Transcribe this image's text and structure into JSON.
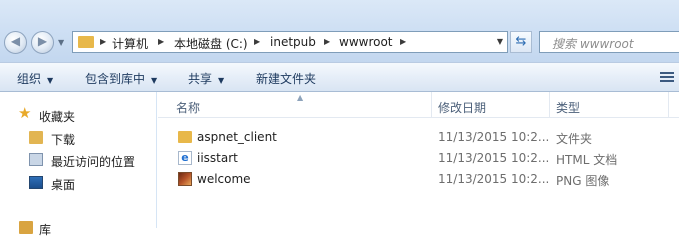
{
  "address": {
    "crumbs": [
      "计算机",
      "本地磁盘 (C:)",
      "inetpub",
      "wwwroot"
    ]
  },
  "search": {
    "placeholder": "wwwroot"
  },
  "toolbar": {
    "organize": "组织",
    "include_in_library": "包含到库中",
    "share": "共享",
    "new_folder": "新建文件夹"
  },
  "nav": {
    "favorites": "收藏夹",
    "downloads": "下载",
    "recent": "最近访问的位置",
    "desktop": "桌面",
    "libraries": "库"
  },
  "columns": {
    "name": "名称",
    "modified": "修改日期",
    "type": "类型"
  },
  "files": [
    {
      "name": "aspnet_client",
      "modified": "11/13/2015 10:2...",
      "type": "文件夹",
      "icon": "folder-icon"
    },
    {
      "name": "iisstart",
      "modified": "11/13/2015 10:2...",
      "type": "HTML 文档",
      "icon": "ie-html-icon"
    },
    {
      "name": "welcome",
      "modified": "11/13/2015 10:2...",
      "type": "PNG 图像",
      "icon": "png-image-icon"
    }
  ],
  "colors": {
    "accent": "#2d6db3",
    "folder": "#e8b84a",
    "toolbar_text": "#1e3a5f"
  }
}
